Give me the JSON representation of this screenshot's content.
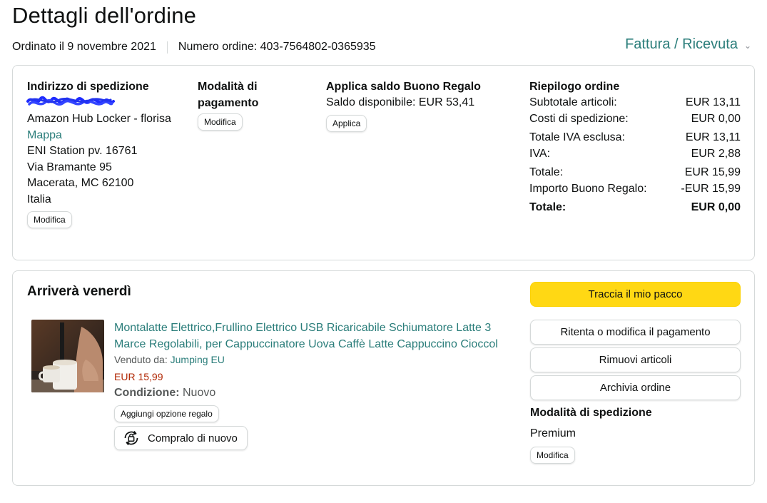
{
  "page": {
    "title": "Dettagli dell'ordine",
    "ordered_on": "Ordinato il 9 novembre 2021",
    "order_number": "Numero ordine: 403-7564802-0365935",
    "invoice_link": "Fattura / Ricevuta"
  },
  "shipping": {
    "header": "Indirizzo di spedizione",
    "line1": "Amazon Hub Locker - florisa",
    "map_link": "Mappa",
    "line2": "ENI Station pv. 16761",
    "line3": "Via Bramante 95",
    "line4": "Macerata, MC 62100",
    "line5": "Italia",
    "edit_label": "Modifica"
  },
  "payment": {
    "header_line1": "Modalità di",
    "header_line2": "pagamento",
    "edit_label": "Modifica"
  },
  "gift": {
    "header": "Applica saldo Buono Regalo",
    "balance": "Saldo disponibile: EUR 53,41",
    "apply_label": "Applica"
  },
  "summary": {
    "header": "Riepilogo ordine",
    "rows": [
      {
        "label": "Subtotale articoli:",
        "value": "EUR 13,11"
      },
      {
        "label": "Costi di spedizione:",
        "value": "EUR 0,00"
      },
      {
        "label": "Totale IVA esclusa:",
        "value": "EUR 13,11"
      },
      {
        "label": "IVA:",
        "value": "EUR 2,88"
      },
      {
        "label": "Totale:",
        "value": "EUR 15,99"
      },
      {
        "label": "Importo Buono Regalo:",
        "value": "-EUR 15,99"
      },
      {
        "label": "Totale:",
        "value": "EUR 0,00"
      }
    ]
  },
  "delivery": {
    "title": "Arriverà venerdì",
    "product_title": "Montalatte Elettrico,Frullino Elettrico USB Ricaricabile Schiumatore Latte 3 Marce Regolabili, per Cappuccinatore Uova Caffè Latte Cappuccino Cioccol",
    "sold_by_label": "Venduto da:",
    "seller": "Jumping EU",
    "price": "EUR 15,99",
    "condition_label": "Condizione:",
    "condition_value": "Nuovo",
    "gift_option": "Aggiungi opzione regalo",
    "buy_again": "Compralo di nuovo",
    "track_button": "Traccia il mio pacco",
    "retry_payment_button": "Ritenta o modifica il pagamento",
    "remove_items_button": "Rimuovi articoli",
    "archive_button": "Archivia ordine",
    "shipping_mode_header": "Modalità di spedizione",
    "shipping_mode_value": "Premium",
    "shipping_mode_edit": "Modifica"
  },
  "colors": {
    "link": "#2a7d7a",
    "price": "#b12704",
    "primary_button": "#ffd814",
    "border": "#d5d9d9"
  }
}
